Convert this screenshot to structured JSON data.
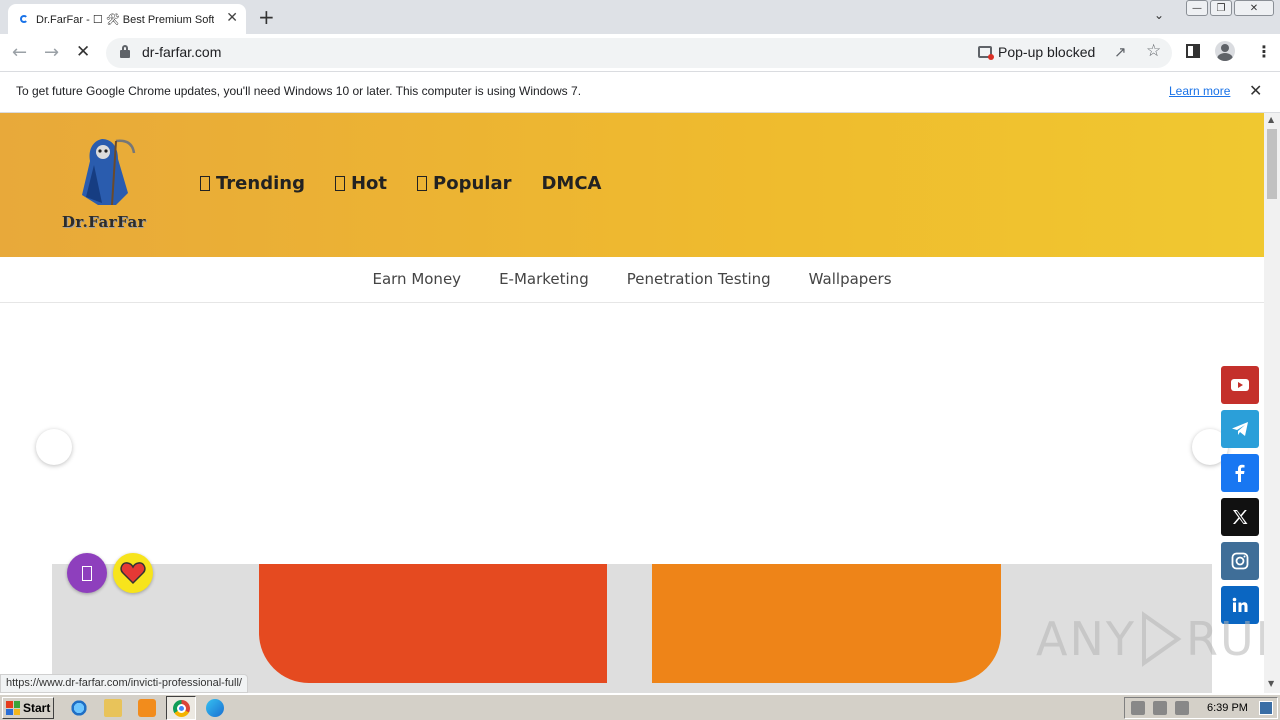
{
  "browser": {
    "tab_title": "Dr.FarFar - ☐ 🛠 Best Premium Softw",
    "tab_close": "✕",
    "new_tab": "+",
    "window_controls": [
      "—",
      "❐",
      "✕"
    ],
    "url": "dr-farfar.com",
    "popup_blocked": "Pop-up blocked",
    "infobar_text": "To get future Google Chrome updates, you'll need Windows 10 or later. This computer is using Windows 7.",
    "learn_more": "Learn more",
    "status_url": "https://www.dr-farfar.com/invicti-professional-full/"
  },
  "site": {
    "logo_text": "Dr.FarFar",
    "main_nav": [
      {
        "icon": "box-glyph-icon",
        "label": "Trending"
      },
      {
        "icon": "box-glyph-icon",
        "label": "Hot"
      },
      {
        "icon": "box-glyph-icon",
        "label": "Popular"
      },
      {
        "icon": "",
        "label": "DMCA"
      }
    ],
    "sub_nav": [
      "Earn Money",
      "E-Marketing",
      "Penetration Testing",
      "Wallpapers"
    ],
    "social": [
      {
        "name": "youtube",
        "color": "#c4302b"
      },
      {
        "name": "telegram",
        "color": "#2b9fd9"
      },
      {
        "name": "facebook",
        "color": "#1877f2"
      },
      {
        "name": "x",
        "color": "#111111"
      },
      {
        "name": "instagram",
        "color": "#3f6e98"
      },
      {
        "name": "linkedin",
        "color": "#0a66c2"
      }
    ],
    "header_gradient": [
      "#e8a93a",
      "#f0c830"
    ],
    "banner_colors": [
      "#e54a20",
      "#ee8418"
    ]
  },
  "watermark": {
    "left": "ANY",
    "right": "RUN"
  },
  "taskbar": {
    "start_label": "Start",
    "clock": "6:39 PM"
  }
}
